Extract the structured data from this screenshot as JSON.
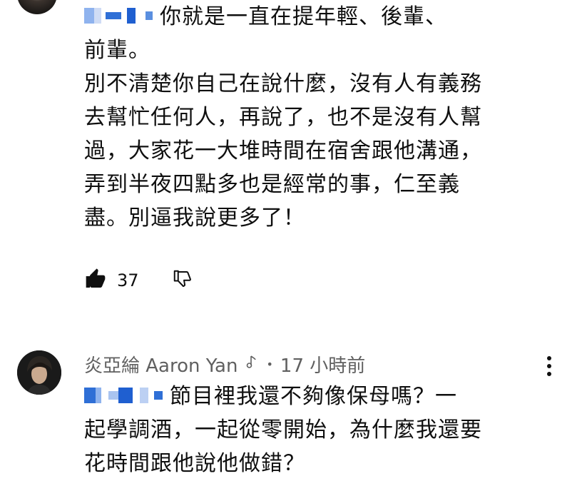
{
  "comment1": {
    "text_line1": "你就是一直在提年輕、後輩、",
    "text_rest": "前輩。\n別不清楚你自己在說什麼，沒有人有義務去幫忙任何人，再說了，也不是沒有人幫過，大家花一大堆時間在宿舍跟他溝通，弄到半夜四點多也是經常的事，仁至義盡。別逼我說更多了！",
    "lines": [
      "前輩。",
      "別不清楚你自己在說什麼，沒有人有義務",
      "去幫忙任何人，再說了，也不是沒有人幫",
      "過，大家花一大堆時間在宿舍跟他溝通，",
      "弄到半夜四點多也是經常的事，仁至義",
      "盡。別逼我說更多了！"
    ],
    "like_count": "37"
  },
  "comment2": {
    "author": "炎亞綸 Aaron Yan",
    "separator": "•",
    "timestamp": "17 小時前",
    "line1": "節目裡我還不夠像保母嗎？一",
    "line2": "起學調酒，一起從零開始，為什麼我還要",
    "line3": "花時間跟他說他做錯？"
  },
  "colors": {
    "text": "#0f0f0f",
    "meta": "#606060",
    "mention_blur": "#2f6fd6"
  },
  "icons": [
    "thumb-up-filled-icon",
    "thumb-down-outline-icon",
    "music-note-icon",
    "more-vert-icon"
  ]
}
